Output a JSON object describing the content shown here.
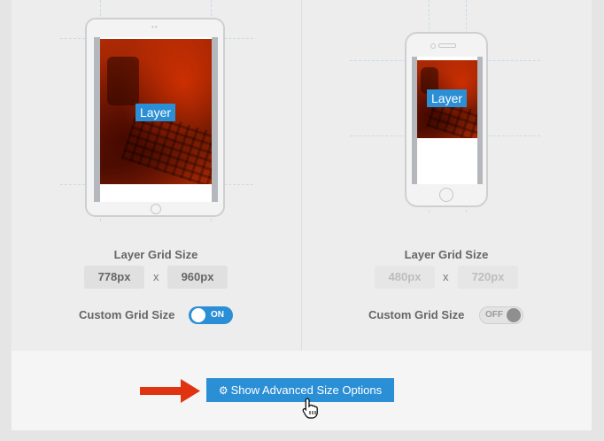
{
  "tablet": {
    "layer_label": "Layer",
    "grid_title": "Layer Grid Size",
    "width_value": "778px",
    "separator": "x",
    "height_value": "960px",
    "custom_grid_label": "Custom Grid Size",
    "custom_grid_toggle": "ON"
  },
  "phone": {
    "layer_label": "Layer",
    "grid_title": "Layer Grid Size",
    "width_value": "480px",
    "separator": "x",
    "height_value": "720px",
    "custom_grid_label": "Custom Grid Size",
    "custom_grid_toggle": "OFF"
  },
  "footer": {
    "advanced_button_label": "Show Advanced Size Options",
    "button_icon": "gear-icon"
  },
  "colors": {
    "accent": "#2b8fd6",
    "arrow": "#e0330f"
  }
}
